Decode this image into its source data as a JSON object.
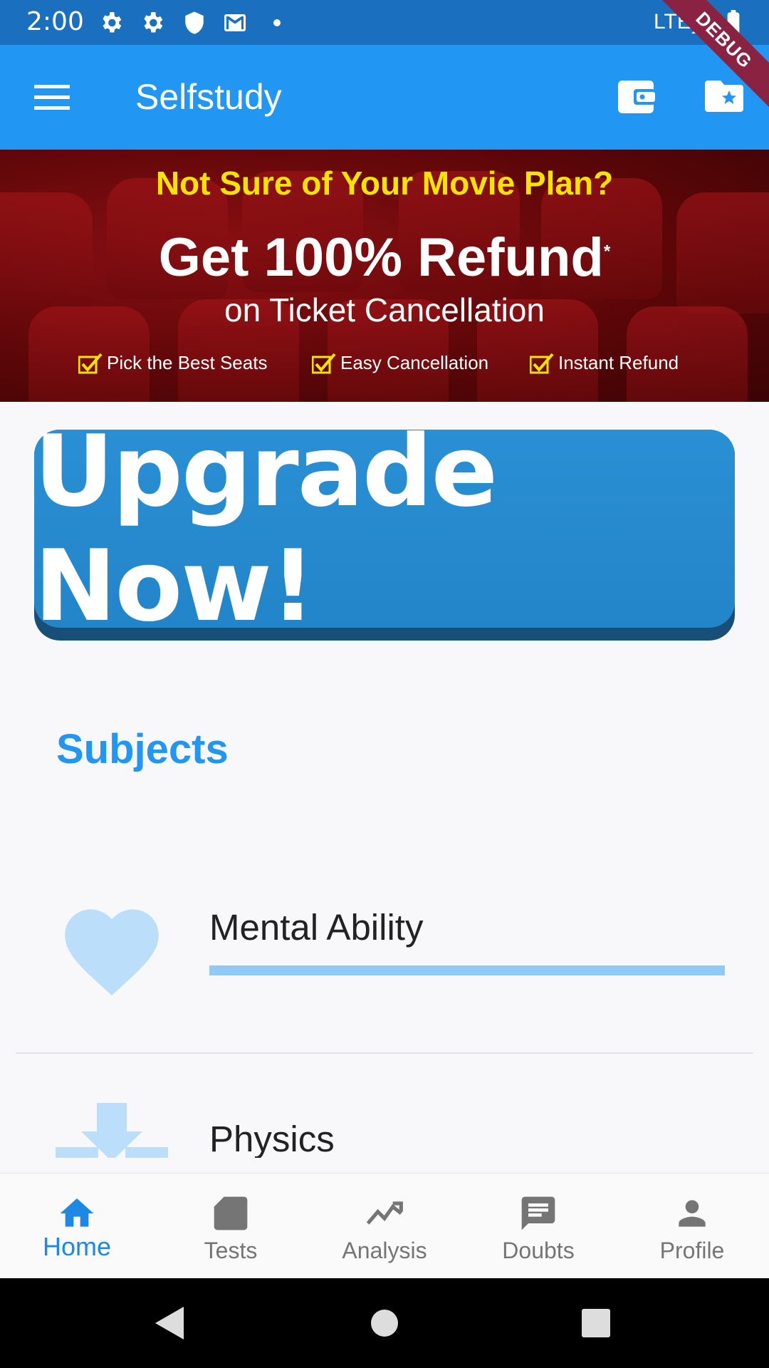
{
  "status_bar": {
    "time": "2:00",
    "network": "LTE"
  },
  "debug_banner": "DEBUG",
  "app_bar": {
    "title": "Selfstudy"
  },
  "banner": {
    "headline": "Not Sure of Your Movie Plan?",
    "main": "Get 100% Refund",
    "asterisk": "*",
    "sub": "on Ticket Cancellation",
    "features": [
      "Pick the Best Seats",
      "Easy Cancellation",
      "Instant Refund"
    ]
  },
  "upgrade": {
    "label": "Upgrade Now!"
  },
  "subjects": {
    "title": "Subjects",
    "items": [
      {
        "name": "Mental Ability",
        "icon": "heart-icon",
        "progress": 1.0
      },
      {
        "name": "Physics",
        "icon": "download-icon"
      }
    ]
  },
  "bottom_nav": {
    "items": [
      {
        "label": "Home",
        "icon": "home-icon",
        "active": true
      },
      {
        "label": "Tests",
        "icon": "tests-icon"
      },
      {
        "label": "Analysis",
        "icon": "analysis-icon"
      },
      {
        "label": "Doubts",
        "icon": "doubts-icon"
      },
      {
        "label": "Profile",
        "icon": "profile-icon"
      }
    ]
  },
  "colors": {
    "primary": "#2196f3",
    "status_bar": "#1a6fbf",
    "accent_light": "#90caf9",
    "debug": "#8a2342"
  }
}
